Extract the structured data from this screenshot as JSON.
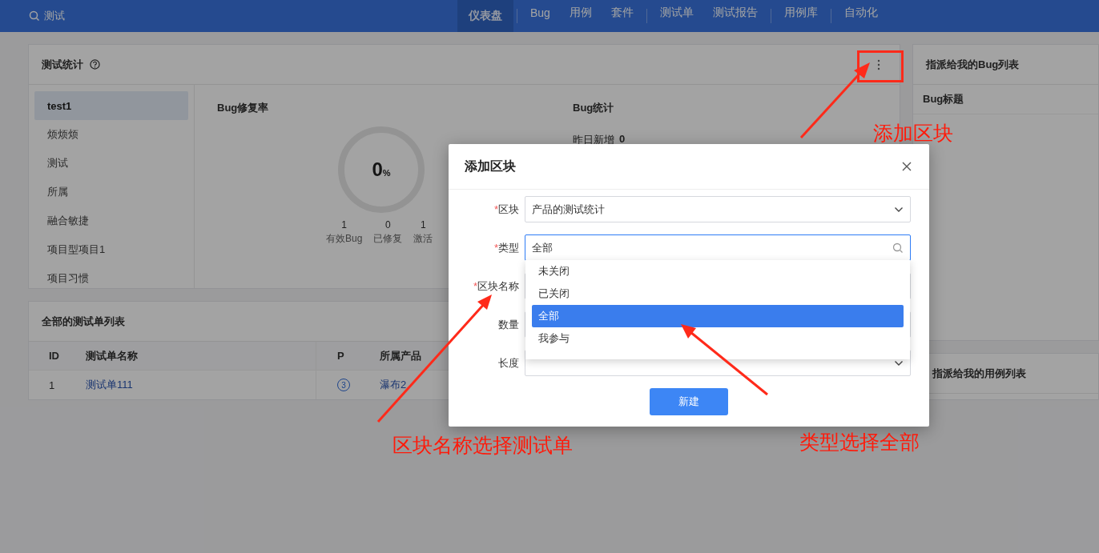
{
  "nav": {
    "search_label": "测试",
    "groups": [
      {
        "items": [
          {
            "label": "仪表盘",
            "selected": true
          }
        ]
      },
      {
        "items": [
          {
            "label": "Bug",
            "selected": false
          },
          {
            "label": "用例",
            "selected": false
          },
          {
            "label": "套件",
            "selected": false
          }
        ]
      },
      {
        "items": [
          {
            "label": "测试单",
            "selected": false
          },
          {
            "label": "测试报告",
            "selected": false
          }
        ]
      },
      {
        "items": [
          {
            "label": "用例库",
            "selected": false
          }
        ]
      },
      {
        "items": [
          {
            "label": "自动化",
            "selected": false
          }
        ]
      }
    ]
  },
  "test_stats": {
    "title": "测试统计",
    "sidebar": [
      {
        "label": "test1",
        "selected": true
      },
      {
        "label": "烦烦烦",
        "selected": false
      },
      {
        "label": "测试",
        "selected": false
      },
      {
        "label": "所属",
        "selected": false
      },
      {
        "label": "融合敏捷",
        "selected": false
      },
      {
        "label": "项目型项目1",
        "selected": false
      },
      {
        "label": "项目习惯",
        "selected": false
      }
    ],
    "fix_rate": {
      "title": "Bug修复率",
      "value": "0",
      "unit": "%",
      "stats": [
        {
          "value": "1",
          "label": "有效Bug"
        },
        {
          "value": "0",
          "label": "已修复"
        },
        {
          "value": "1",
          "label": "激活"
        }
      ]
    },
    "bug_stats": {
      "title": "Bug统计",
      "items": [
        {
          "label": "昨日新增",
          "value": "0"
        }
      ]
    }
  },
  "testsheet_list": {
    "title": "全部的测试单列表",
    "columns": [
      "ID",
      "测试单名称",
      "P",
      "所属产品"
    ],
    "rows": [
      {
        "id": "1",
        "name": "测试单111",
        "priority": "3",
        "product": "瀑布2"
      }
    ]
  },
  "bug_list": {
    "title": "指派给我的Bug列表",
    "column": "Bug标题"
  },
  "case_list": {
    "title": "指派给我的用例列表"
  },
  "modal": {
    "title": "添加区块",
    "fields": [
      {
        "label": "区块",
        "required_mark": "*",
        "kind": "select",
        "value": "产品的测试统计",
        "focused": false
      },
      {
        "label": "类型",
        "required_mark": "*",
        "kind": "search",
        "value": "全部",
        "focused": true
      },
      {
        "label": "区块名称",
        "required_mark": "*",
        "kind": "input",
        "focused": false
      },
      {
        "label": "数量",
        "kind": "input",
        "focused": false
      },
      {
        "label": "长度",
        "kind": "select",
        "focused": false
      }
    ],
    "options": [
      {
        "label": "未关闭",
        "selected": false
      },
      {
        "label": "已关闭",
        "selected": false
      },
      {
        "label": "全部",
        "selected": true
      },
      {
        "label": "我参与",
        "selected": false
      }
    ],
    "submit": "新建"
  },
  "annotations": [
    {
      "text": "添加区块"
    },
    {
      "text": "区块名称选择测试单"
    },
    {
      "text": "类型选择全部"
    }
  ]
}
